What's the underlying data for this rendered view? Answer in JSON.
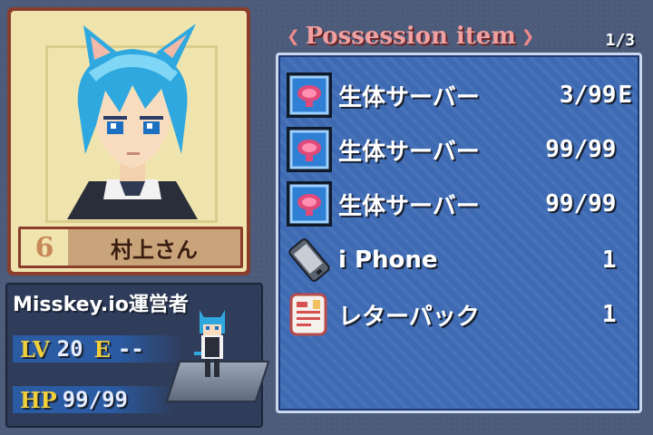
{
  "character": {
    "name": "村上さん",
    "number": "6",
    "title": "Misskey.io運営者",
    "lv_label": "LV",
    "lv_value": "20",
    "exp_label": "E",
    "exp_value": "--",
    "hp_label": "HP",
    "hp_value": "99/99"
  },
  "inventory": {
    "title": "Possession item",
    "page": "1/3",
    "items": [
      {
        "name": "生体サーバー",
        "qty": "3/99",
        "flag": "E",
        "icon": "bio-server-icon"
      },
      {
        "name": "生体サーバー",
        "qty": "99/99",
        "flag": "",
        "icon": "bio-server-icon"
      },
      {
        "name": "生体サーバー",
        "qty": "99/99",
        "flag": "",
        "icon": "bio-server-icon"
      },
      {
        "name": "i Phone",
        "qty": "1",
        "flag": "",
        "icon": "phone-icon"
      },
      {
        "name": "レターパック",
        "qty": "1",
        "flag": "",
        "icon": "letter-pack-icon"
      }
    ]
  },
  "colors": {
    "accent_title": "#f0a0a0",
    "panel_blue": "#3d6ab3",
    "stat_label": "#f1cf3a"
  }
}
